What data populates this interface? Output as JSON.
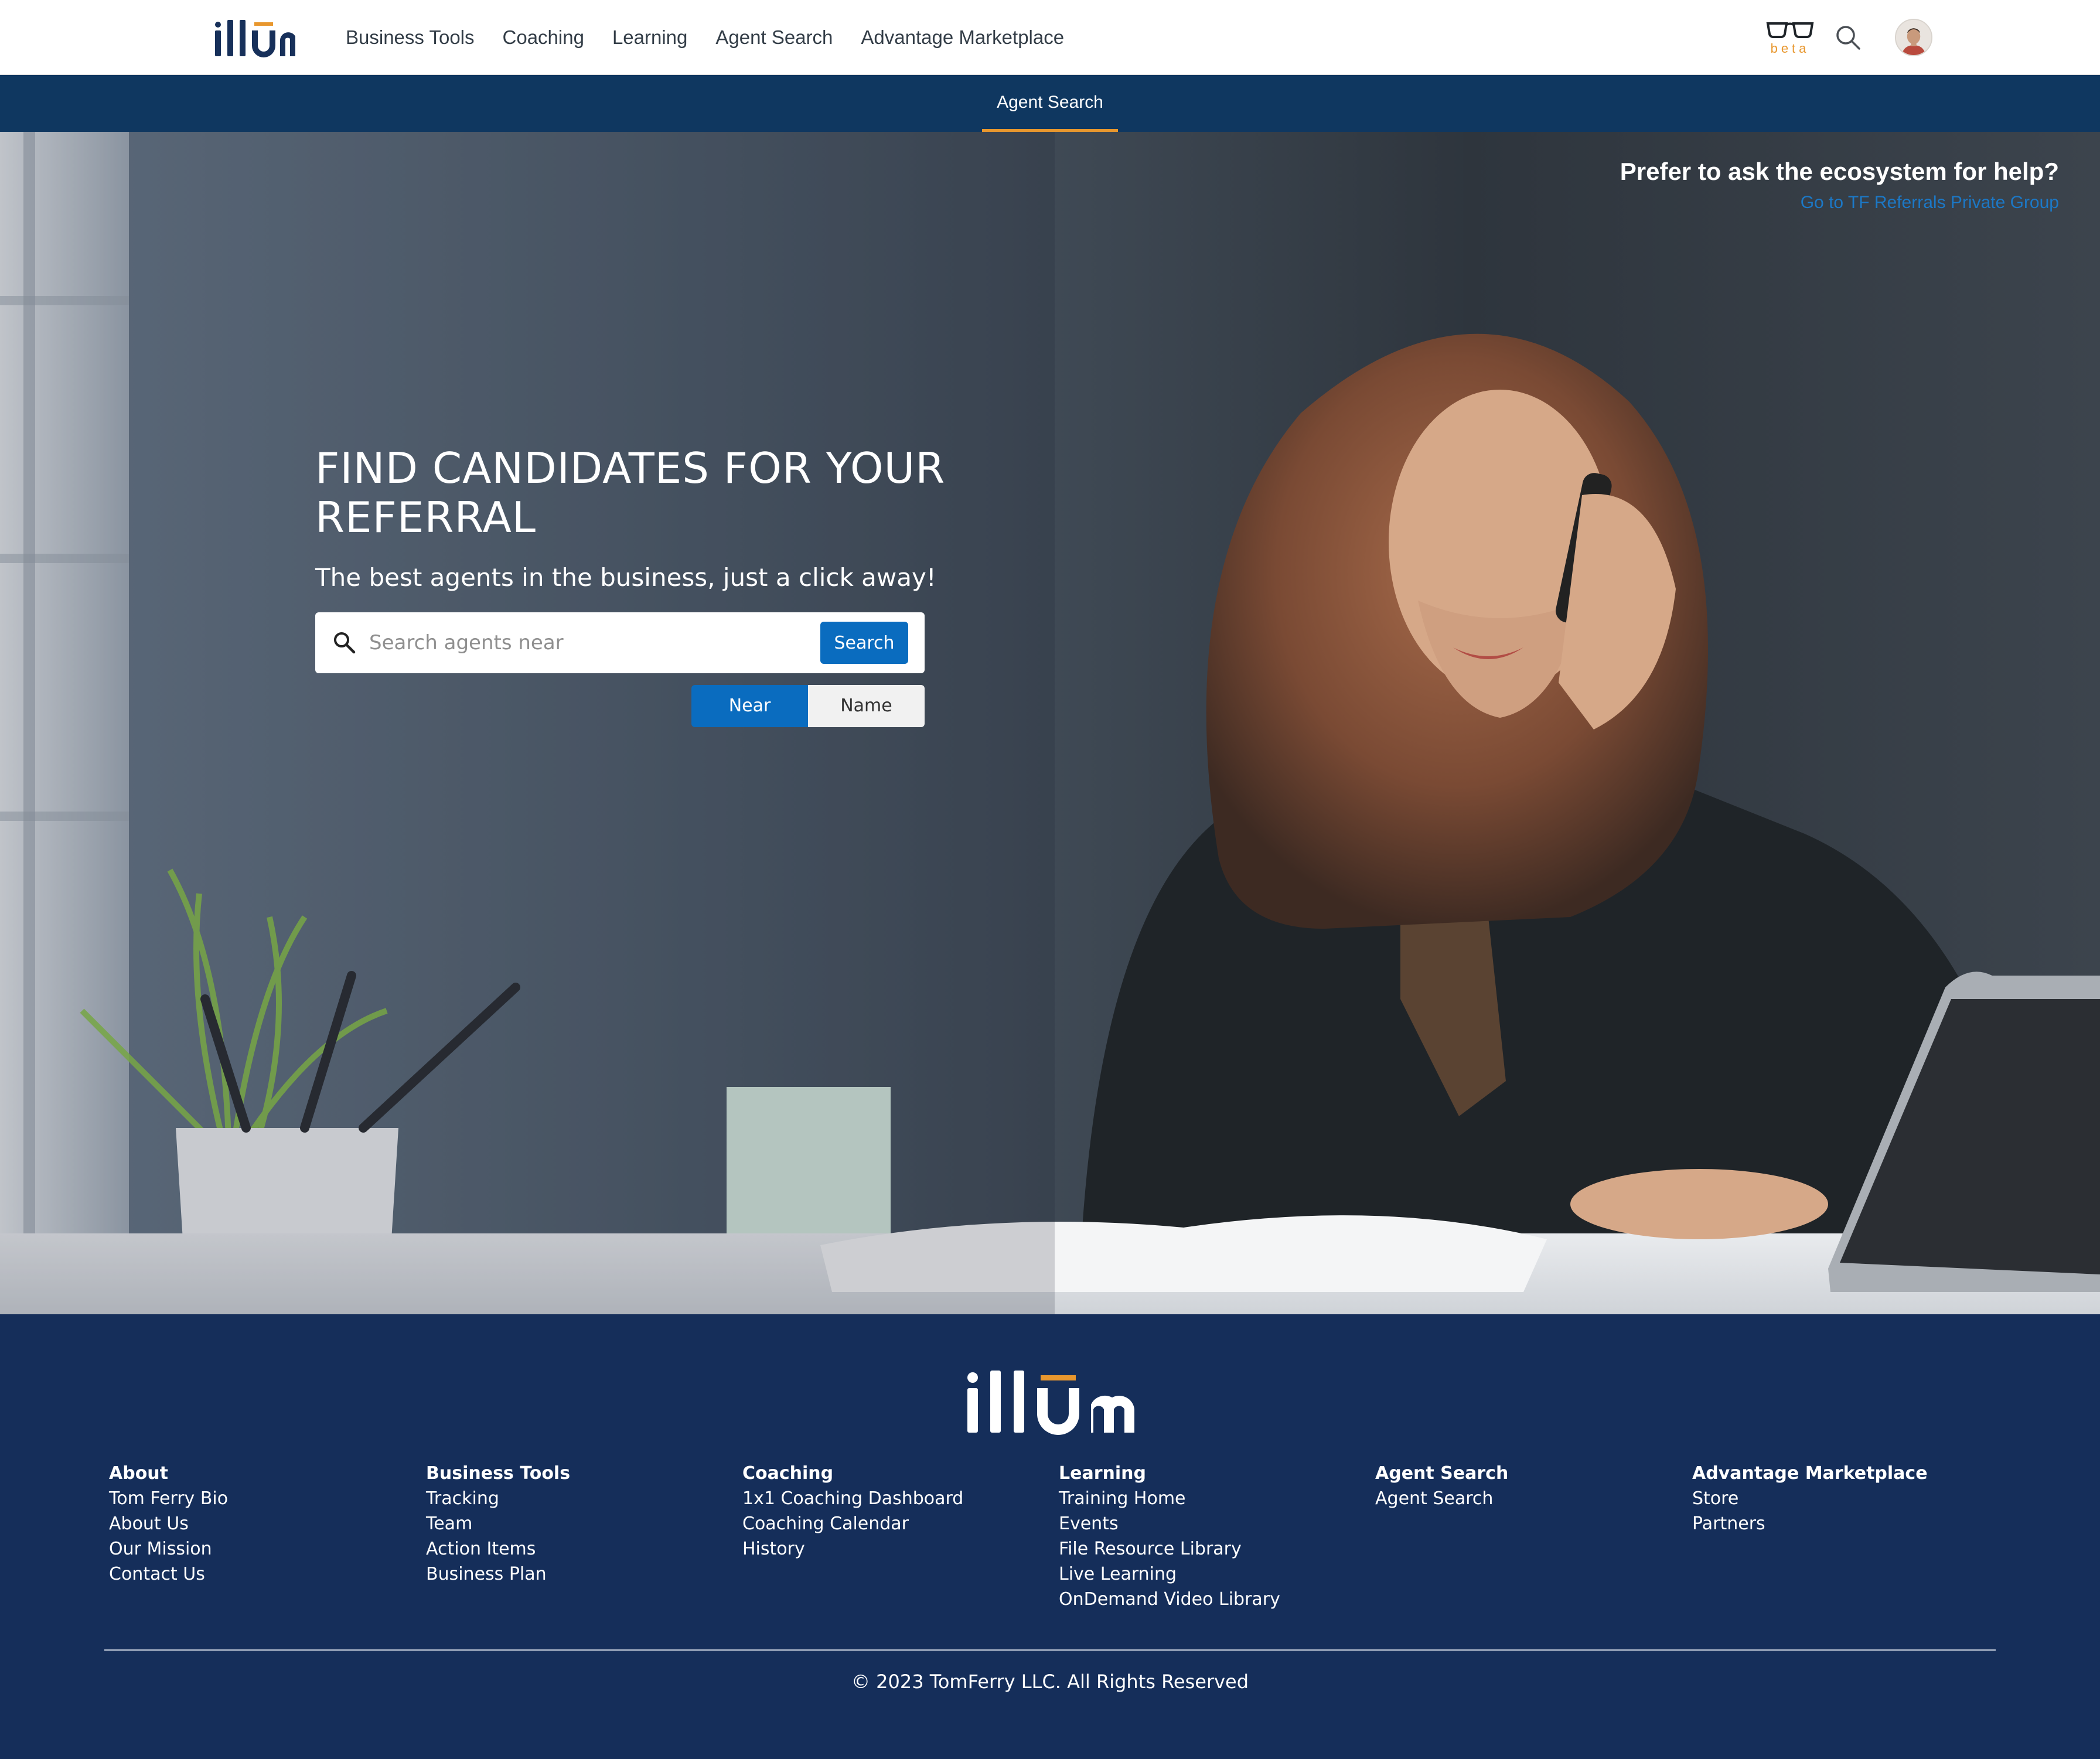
{
  "app": {
    "logo_text": "illūm"
  },
  "nav": {
    "links": [
      "Business Tools",
      "Coaching",
      "Learning",
      "Agent Search",
      "Advantage Marketplace"
    ],
    "beta_label": "beta"
  },
  "subnav": {
    "active_tab": "Agent Search"
  },
  "hero": {
    "help_title": "Prefer to ask the ecosystem for help?",
    "help_link": "Go to TF Referrals Private Group",
    "title": "FIND CANDIDATES FOR YOUR REFERRAL",
    "subtitle": "The best agents in the business, just a click away!",
    "search": {
      "placeholder": "Search agents near",
      "value": "",
      "button_label": "Search"
    },
    "toggle": {
      "options": [
        "Near",
        "Name"
      ],
      "selected": "Near"
    }
  },
  "footer": {
    "columns": [
      {
        "title": "About",
        "items": [
          "Tom Ferry Bio",
          "About Us",
          "Our Mission",
          "Contact Us"
        ]
      },
      {
        "title": "Business Tools",
        "items": [
          "Tracking",
          "Team",
          "Action Items",
          "Business Plan"
        ]
      },
      {
        "title": "Coaching",
        "items": [
          "1x1 Coaching Dashboard",
          "Coaching Calendar",
          "History"
        ]
      },
      {
        "title": "Learning",
        "items": [
          "Training Home",
          "Events",
          "File Resource Library",
          "Live Learning",
          "OnDemand Video Library"
        ]
      },
      {
        "title": "Agent Search",
        "items": [
          "Agent Search"
        ]
      },
      {
        "title": "Advantage Marketplace",
        "items": [
          "Store",
          "Partners"
        ]
      }
    ],
    "copyright": "© 2023 TomFerry LLC. All Rights Reserved"
  },
  "colors": {
    "nav_bar": "#0f3760",
    "accent": "#e8972e",
    "primary_button": "#0a6cbf",
    "footer_bg": "#152e5a",
    "link_blue": "#1c78c6"
  },
  "icons": [
    "glasses-icon",
    "search-icon",
    "avatar",
    "search-icon"
  ]
}
